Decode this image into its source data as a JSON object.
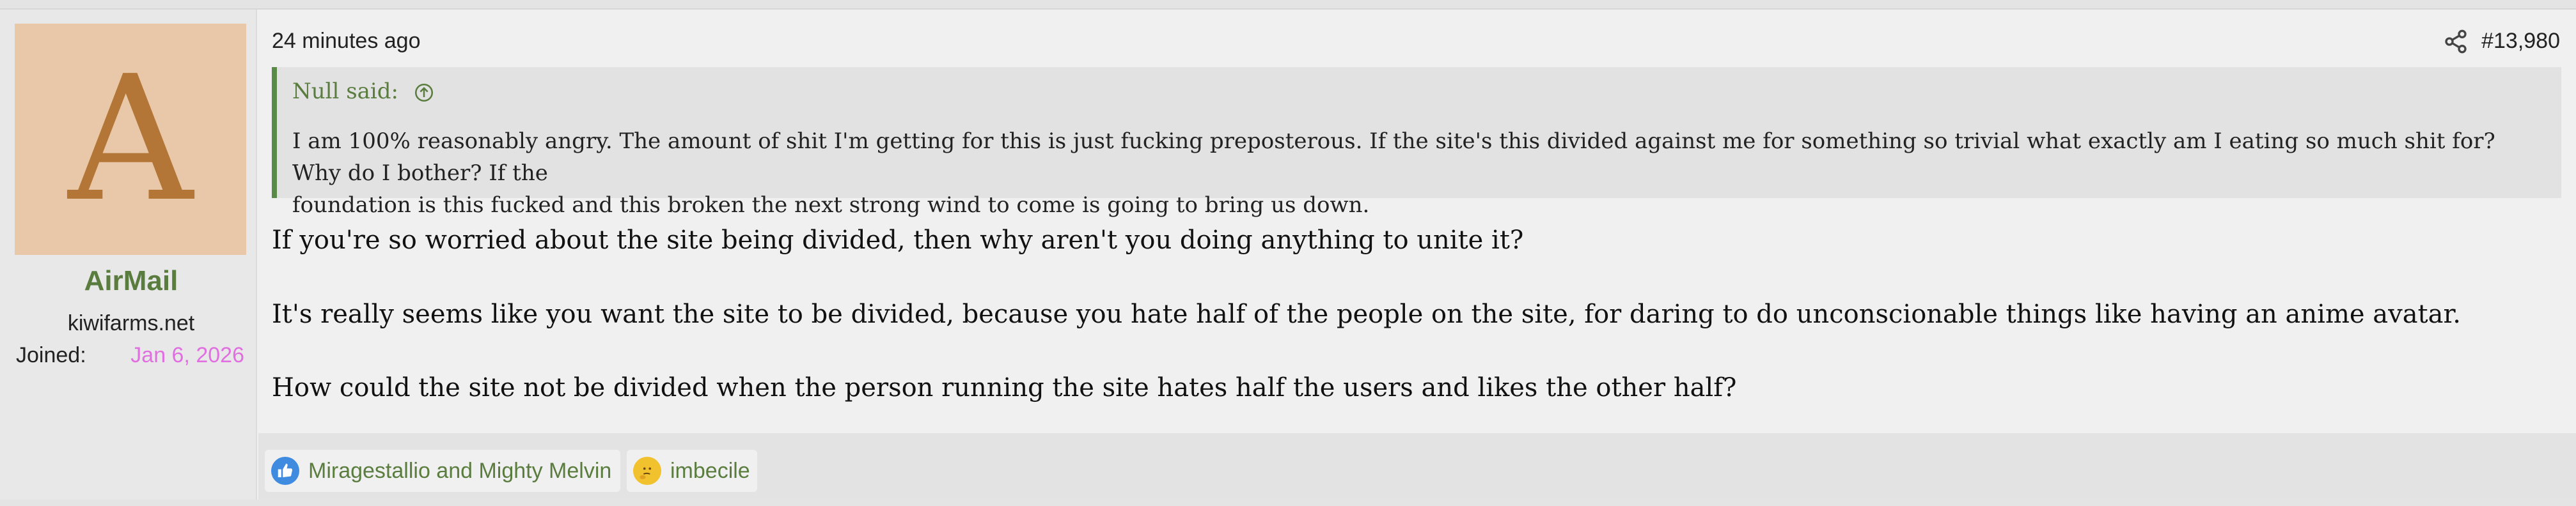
{
  "author": {
    "avatar_letter": "A",
    "username": "AirMail",
    "user_title": "kiwifarms.net",
    "joined_label": "Joined:",
    "joined_date": "Jan 6, 2026"
  },
  "post": {
    "timestamp": "24 minutes ago",
    "post_number": "#13,980",
    "quote": {
      "author_label": "Null said:",
      "lines": [
        "I am 100% reasonably angry. The amount of shit I'm getting for this is just fucking preposterous. If the site's this divided against me for something so trivial what exactly am I eating so much shit for? Why do I bother? If the",
        "foundation is this fucked and this broken the next strong wind to come is going to bring us down."
      ]
    },
    "paragraphs": [
      "If you're so worried about the site being divided, then why aren't you doing anything to unite it?",
      "It's really seems like you want the site to be divided, because you hate half of the people on the site, for daring to do unconscionable things like having an anime avatar.",
      "How could the site not be divided when the person running the site hates half the users and likes the other half?"
    ]
  },
  "reactions": [
    {
      "icon": "like-icon",
      "label": "Miragestallio and Mighty Melvin"
    },
    {
      "icon": "thinking-emoji-icon",
      "label": "imbecile"
    }
  ],
  "colors": {
    "accent_green": "#5a7d3f",
    "avatar_bg": "#e8c8a8",
    "avatar_letter": "#b37636",
    "joined_date": "#e070e0"
  }
}
